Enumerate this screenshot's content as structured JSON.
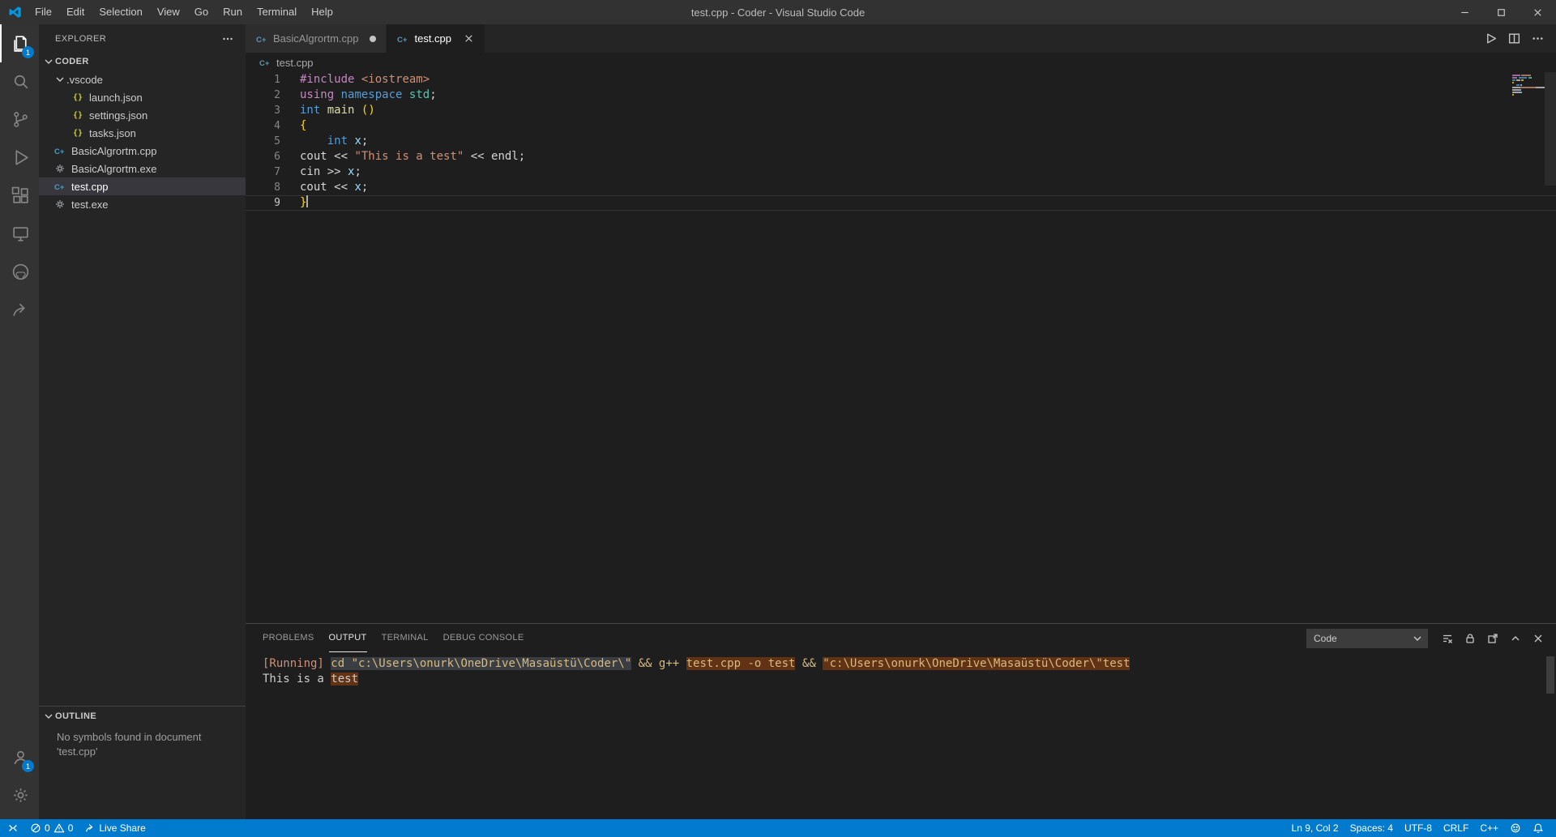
{
  "title_bar": {
    "title": "test.cpp - Coder - Visual Studio Code",
    "menus": [
      "File",
      "Edit",
      "Selection",
      "View",
      "Go",
      "Run",
      "Terminal",
      "Help"
    ],
    "controls": [
      "minimize",
      "maximize",
      "close"
    ]
  },
  "activity_bar": {
    "top": [
      {
        "name": "explorer",
        "icon": "files",
        "active": true,
        "badge": "1"
      },
      {
        "name": "search",
        "icon": "search"
      },
      {
        "name": "source-control",
        "icon": "source-control"
      },
      {
        "name": "run-and-debug",
        "icon": "debug"
      },
      {
        "name": "extensions",
        "icon": "extensions"
      },
      {
        "name": "remote-explorer",
        "icon": "remote-explorer"
      },
      {
        "name": "github",
        "icon": "github"
      },
      {
        "name": "live-share",
        "icon": "live-share"
      }
    ],
    "bottom": [
      {
        "name": "account",
        "icon": "account",
        "badge": "1"
      },
      {
        "name": "settings",
        "icon": "settings"
      }
    ]
  },
  "sidebar": {
    "header": "EXPLORER",
    "files": [
      {
        "label": "CODER",
        "indent": 0,
        "chevron": true,
        "root": true
      },
      {
        "label": ".vscode",
        "indent": 1,
        "chevron": true
      },
      {
        "label": "launch.json",
        "indent": 2,
        "icon": "json"
      },
      {
        "label": "settings.json",
        "indent": 2,
        "icon": "json"
      },
      {
        "label": "tasks.json",
        "indent": 2,
        "icon": "json"
      },
      {
        "label": "BasicAlgrortm.cpp",
        "indent": 1,
        "icon": "cpp"
      },
      {
        "label": "BasicAlgrortm.exe",
        "indent": 1,
        "icon": "exe"
      },
      {
        "label": "test.cpp",
        "indent": 1,
        "icon": "cpp",
        "selected": true
      },
      {
        "label": "test.exe",
        "indent": 1,
        "icon": "exe"
      }
    ],
    "outline": {
      "header": "OUTLINE",
      "message": "No symbols found in document 'test.cpp'"
    }
  },
  "editor": {
    "tabs": [
      {
        "label": "BasicAlgrortm.cpp",
        "icon": "cpp",
        "modified": true
      },
      {
        "label": "test.cpp",
        "icon": "cpp",
        "active": true
      }
    ],
    "breadcrumb": "test.cpp",
    "code_lines": [
      {
        "num": "1",
        "tokens": [
          [
            "#include",
            "kw"
          ],
          [
            " ",
            "pl"
          ],
          [
            "<iostream>",
            "str"
          ]
        ]
      },
      {
        "num": "2",
        "tokens": [
          [
            "using",
            "kw"
          ],
          [
            " ",
            "pl"
          ],
          [
            "namespace",
            "type"
          ],
          [
            " ",
            "pl"
          ],
          [
            "std",
            "cls"
          ],
          [
            ";",
            "pl"
          ]
        ]
      },
      {
        "num": "3",
        "tokens": [
          [
            "int",
            "type"
          ],
          [
            " ",
            "pl"
          ],
          [
            "main",
            "fn"
          ],
          [
            " ",
            "pl"
          ],
          [
            "()",
            "bracket"
          ]
        ]
      },
      {
        "num": "4",
        "tokens": [
          [
            "{",
            "bracket"
          ]
        ]
      },
      {
        "num": "5",
        "tokens": [
          [
            "    ",
            "pl"
          ],
          [
            "int",
            "type"
          ],
          [
            " ",
            "pl"
          ],
          [
            "x",
            "var"
          ],
          [
            ";",
            "pl"
          ]
        ]
      },
      {
        "num": "6",
        "tokens": [
          [
            "cout << ",
            "pl"
          ],
          [
            "\"This is a test\"",
            "str"
          ],
          [
            " << endl;",
            "pl"
          ]
        ]
      },
      {
        "num": "7",
        "tokens": [
          [
            "cin >> ",
            "pl"
          ],
          [
            "x",
            "var"
          ],
          [
            ";",
            "pl"
          ]
        ]
      },
      {
        "num": "8",
        "tokens": [
          [
            "cout << ",
            "pl"
          ],
          [
            "x",
            "var"
          ],
          [
            ";",
            "pl"
          ]
        ]
      },
      {
        "num": "9",
        "tokens": [
          [
            "}",
            "bracket"
          ]
        ],
        "current": true
      }
    ]
  },
  "panel": {
    "tabs": [
      {
        "label": "PROBLEMS"
      },
      {
        "label": "OUTPUT",
        "active": true
      },
      {
        "label": "TERMINAL"
      },
      {
        "label": "DEBUG CONSOLE"
      }
    ],
    "channel": "Code",
    "action_icons": [
      "clear-output",
      "lock",
      "open-editor",
      "chevron-up",
      "close"
    ],
    "output_lines": [
      {
        "tokens": [
          [
            "[Running] ",
            "run",
            ""
          ],
          [
            "cd \"c:\\Users\\onurk\\OneDrive\\Masaüstü\\Coder\\\"",
            "cmd",
            "dim"
          ],
          [
            " && g++ ",
            "cmd",
            ""
          ],
          [
            "test.cpp -o test",
            "cmd",
            "find"
          ],
          [
            " && ",
            "cmd",
            ""
          ],
          [
            "\"c:\\Users\\onurk\\OneDrive\\Masaüstü\\Coder\\\"test",
            "cmd",
            "find"
          ]
        ]
      },
      {
        "tokens": [
          [
            "This is a ",
            "out",
            ""
          ],
          [
            "test",
            "out",
            "find"
          ]
        ]
      }
    ]
  },
  "status_bar": {
    "errors": "0",
    "warnings": "0",
    "live_share": "Live Share",
    "cursor": "Ln 9, Col 2",
    "indent": "Spaces: 4",
    "encoding": "UTF-8",
    "eol": "CRLF",
    "language": "C++"
  },
  "colors": {
    "accent": "#007ACC",
    "titlebar_bg": "#323233",
    "activitybar_bg": "#333333",
    "sidebar_bg": "#252526",
    "editor_bg": "#1E1E1E",
    "statusbar_bg": "#007ACC",
    "cpp_icon": "#519ABA",
    "json_icon": "#CBCB41",
    "exe_icon": "#9DA0A2"
  },
  "syntax_palette": {
    "pl": "#D4D4D4",
    "kw": "#C586C0",
    "type": "#569CD6",
    "cls": "#4EC9B0",
    "fn": "#DCDCAA",
    "str": "#CE9178",
    "var": "#9CDCFE",
    "bracket": "#FFD700",
    "run": "#CE9178",
    "cmd": "#D7BA7D",
    "out": "#CCCCCC"
  },
  "highlight_colors": {
    "find": "#613214",
    "dim": "#3A3D41"
  }
}
